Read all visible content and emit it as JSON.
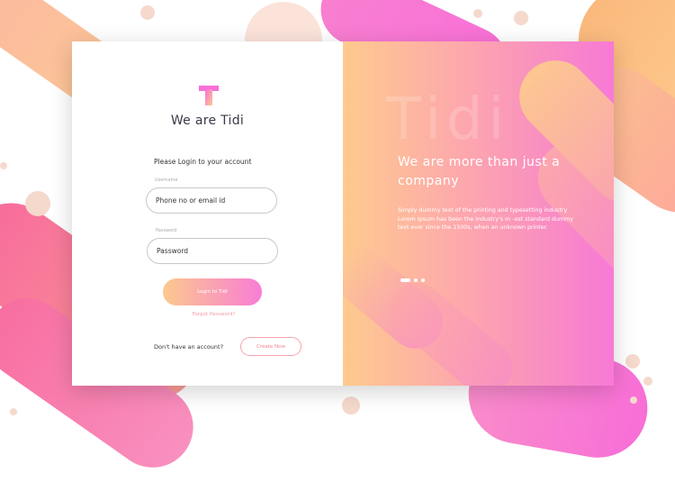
{
  "colors": {
    "accent_pink": "#f879d6",
    "accent_peach": "#fdca8e",
    "link_pink": "#f3848f"
  },
  "brand": {
    "logo_icon": "tidi-logo-icon",
    "name": "We are Tidi"
  },
  "login": {
    "subtitle": "Please Login to your account",
    "username_label": "Username",
    "username_value": "Phone no or email id",
    "password_label": "Password",
    "password_value": "Password",
    "login_button": "Login to Tidi",
    "forgot_link": "Forgot Password?",
    "no_account_text": "Don't have an account?",
    "create_button": "Create Now"
  },
  "hero": {
    "watermark": "Tidi",
    "headline": "We are more than just a company",
    "paragraph": "Simply dummy text of the printing and typesetting industry Lorem Ipsum has been the industry's m -ost standard dummy text ever since the 1500s, when an unknown printer.",
    "carousel": {
      "slides": 3,
      "active": 1
    }
  }
}
